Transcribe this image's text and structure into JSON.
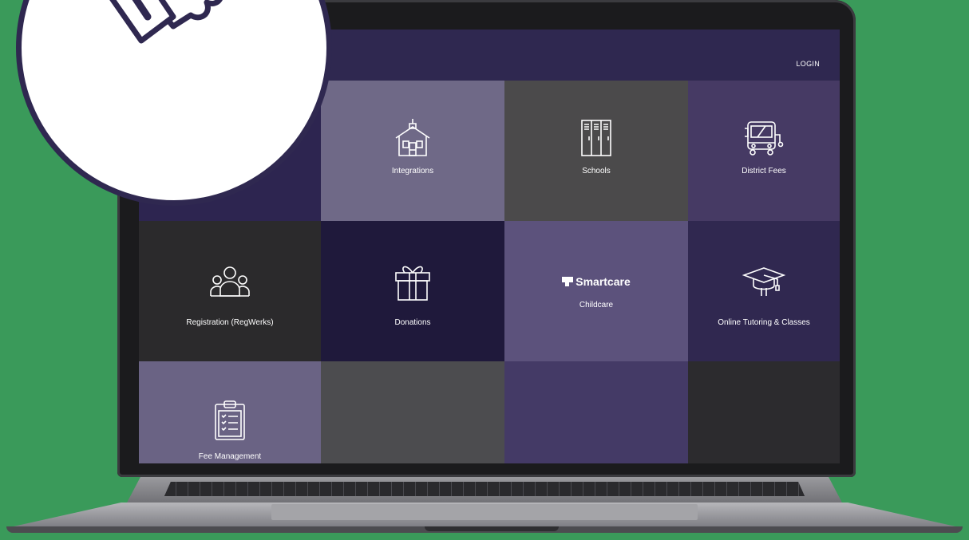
{
  "header": {
    "login_label": "LOGIN"
  },
  "tiles": [
    {
      "label": "Integrations",
      "icon": "schoolhouse-icon",
      "bg": "#6f6987"
    },
    {
      "label": "Schools",
      "icon": "lockers-icon",
      "bg": "#4b4a4b"
    },
    {
      "label": "District Fees",
      "icon": "bus-icon",
      "bg": "#463a64"
    },
    {
      "label": "Registration (RegWerks)",
      "icon": "people-group-icon",
      "bg": "#2b2a2c"
    },
    {
      "label": "Donations",
      "icon": "gift-icon",
      "bg": "#1f193b"
    },
    {
      "label": "Childcare",
      "icon": "smartcare-logo",
      "brand": "Smartcare",
      "bg": "#5c527c"
    },
    {
      "label": "Online Tutoring & Classes",
      "icon": "graduation-cap-icon",
      "bg": "#302850"
    },
    {
      "label": "Fee Management",
      "icon": "clipboard-checklist-icon",
      "bg": "#6a6384"
    }
  ],
  "colors": {
    "background": "#3a9a5a",
    "screen_navy": "#2f2850",
    "badge_outline": "#2f2850",
    "badge_fill": "#ffffff"
  }
}
